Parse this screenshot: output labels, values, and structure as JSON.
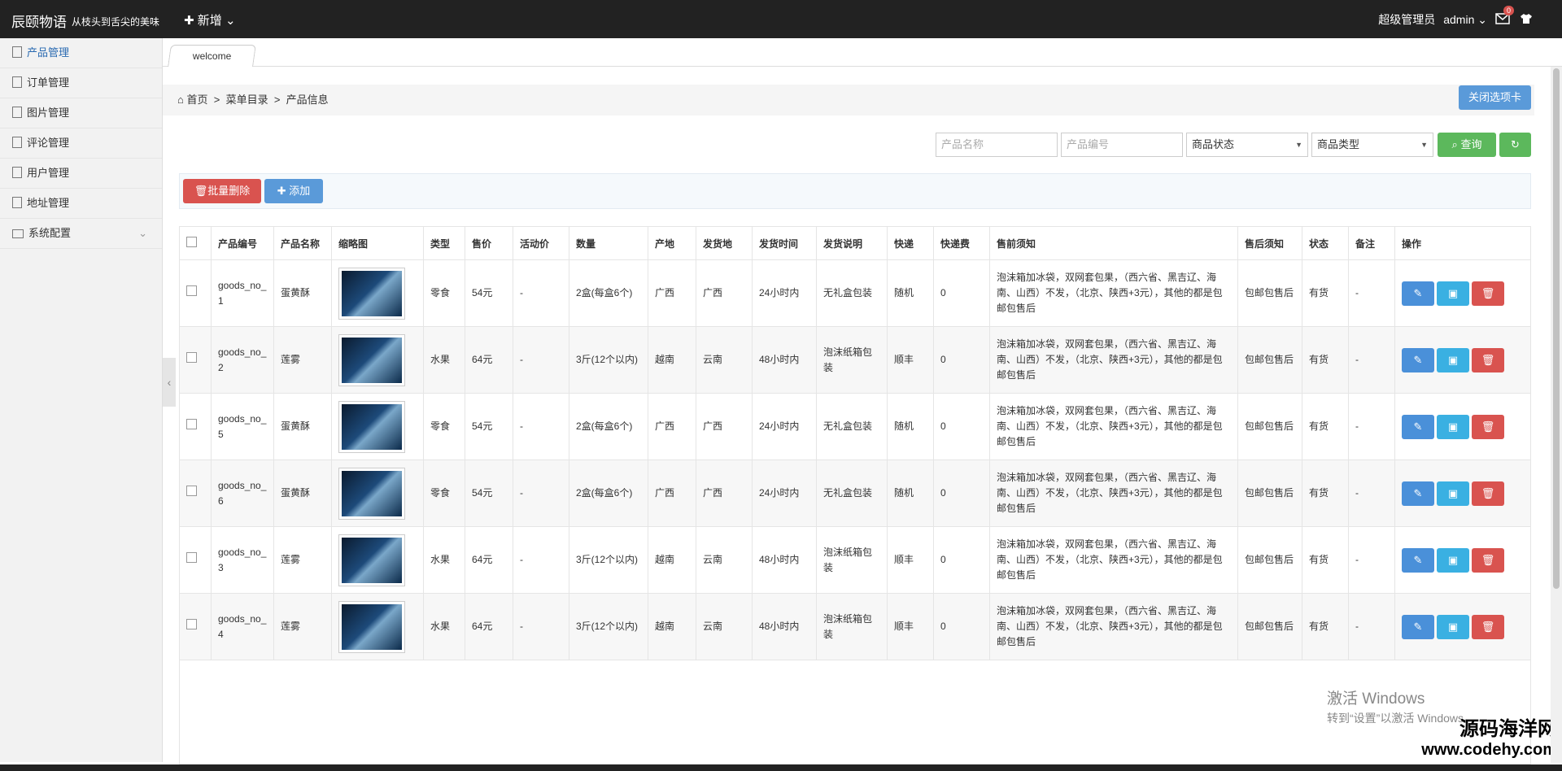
{
  "header": {
    "brand": "辰颐物语",
    "slogan": "从枝头到舌尖的美味",
    "new_label": "新增",
    "user_role": "超级管理员",
    "user_name": "admin",
    "mail_count": "0"
  },
  "sidebar": {
    "items": [
      {
        "label": "产品管理"
      },
      {
        "label": "订单管理"
      },
      {
        "label": "图片管理"
      },
      {
        "label": "评论管理"
      },
      {
        "label": "用户管理"
      },
      {
        "label": "地址管理"
      },
      {
        "label": "系统配置"
      }
    ]
  },
  "tabs": [
    {
      "label": "welcome"
    }
  ],
  "breadcrumb": {
    "home": "首页",
    "sep": ">",
    "level1": "菜单目录",
    "level2": "产品信息"
  },
  "close_tab_label": "关闭选项卡",
  "search": {
    "name_placeholder": "产品名称",
    "code_placeholder": "产品编号",
    "status_select": "商品状态",
    "type_select": "商品类型",
    "query_label": "查询"
  },
  "toolbar": {
    "batch_delete": "批量删除",
    "add": "添加"
  },
  "table": {
    "headers": [
      "产品编号",
      "产品名称",
      "缩略图",
      "类型",
      "售价",
      "活动价",
      "数量",
      "产地",
      "发货地",
      "发货时间",
      "发货说明",
      "快递",
      "快递费",
      "售前须知",
      "售后须知",
      "状态",
      "备注",
      "操作"
    ],
    "rows": [
      {
        "code": "goods_no_1",
        "name": "蛋黄酥",
        "type": "零食",
        "price": "54元",
        "promo": "-",
        "qty": "2盒(每盒6个)",
        "origin": "广西",
        "ship_from": "广西",
        "ship_time": "24小时内",
        "ship_note": "无礼盒包装",
        "express": "随机",
        "fee": "0",
        "pre": "泡沫箱加冰袋，双网套包果，（西六省、黑吉辽、海南、山西）不发，（北京、陕西+3元），其他的都是包邮包售后",
        "post": "包邮包售后",
        "status": "有货",
        "remark": "-"
      },
      {
        "code": "goods_no_2",
        "name": "莲雾",
        "type": "水果",
        "price": "64元",
        "promo": "-",
        "qty": "3斤(12个以内)",
        "origin": "越南",
        "ship_from": "云南",
        "ship_time": "48小时内",
        "ship_note": "泡沫纸箱包装",
        "express": "顺丰",
        "fee": "0",
        "pre": "泡沫箱加冰袋，双网套包果，（西六省、黑吉辽、海南、山西）不发，（北京、陕西+3元），其他的都是包邮包售后",
        "post": "包邮包售后",
        "status": "有货",
        "remark": "-"
      },
      {
        "code": "goods_no_5",
        "name": "蛋黄酥",
        "type": "零食",
        "price": "54元",
        "promo": "-",
        "qty": "2盒(每盒6个)",
        "origin": "广西",
        "ship_from": "广西",
        "ship_time": "24小时内",
        "ship_note": "无礼盒包装",
        "express": "随机",
        "fee": "0",
        "pre": "泡沫箱加冰袋，双网套包果，（西六省、黑吉辽、海南、山西）不发，（北京、陕西+3元），其他的都是包邮包售后",
        "post": "包邮包售后",
        "status": "有货",
        "remark": "-"
      },
      {
        "code": "goods_no_6",
        "name": "蛋黄酥",
        "type": "零食",
        "price": "54元",
        "promo": "-",
        "qty": "2盒(每盒6个)",
        "origin": "广西",
        "ship_from": "广西",
        "ship_time": "24小时内",
        "ship_note": "无礼盒包装",
        "express": "随机",
        "fee": "0",
        "pre": "泡沫箱加冰袋，双网套包果，（西六省、黑吉辽、海南、山西）不发，（北京、陕西+3元），其他的都是包邮包售后",
        "post": "包邮包售后",
        "status": "有货",
        "remark": "-"
      },
      {
        "code": "goods_no_3",
        "name": "莲雾",
        "type": "水果",
        "price": "64元",
        "promo": "-",
        "qty": "3斤(12个以内)",
        "origin": "越南",
        "ship_from": "云南",
        "ship_time": "48小时内",
        "ship_note": "泡沫纸箱包装",
        "express": "顺丰",
        "fee": "0",
        "pre": "泡沫箱加冰袋，双网套包果，（西六省、黑吉辽、海南、山西）不发，（北京、陕西+3元），其他的都是包邮包售后",
        "post": "包邮包售后",
        "status": "有货",
        "remark": "-"
      },
      {
        "code": "goods_no_4",
        "name": "莲雾",
        "type": "水果",
        "price": "64元",
        "promo": "-",
        "qty": "3斤(12个以内)",
        "origin": "越南",
        "ship_from": "云南",
        "ship_time": "48小时内",
        "ship_note": "泡沫纸箱包装",
        "express": "顺丰",
        "fee": "0",
        "pre": "泡沫箱加冰袋，双网套包果，（西六省、黑吉辽、海南、山西）不发，（北京、陕西+3元），其他的都是包邮包售后",
        "post": "包邮包售后",
        "status": "有货",
        "remark": "-"
      }
    ]
  },
  "overlay": {
    "win_activate_1": "激活 Windows",
    "win_activate_2": "转到“设置”以激活 Windows。",
    "watermark_1": "源码海洋网",
    "watermark_2": "www.codehy.com"
  }
}
